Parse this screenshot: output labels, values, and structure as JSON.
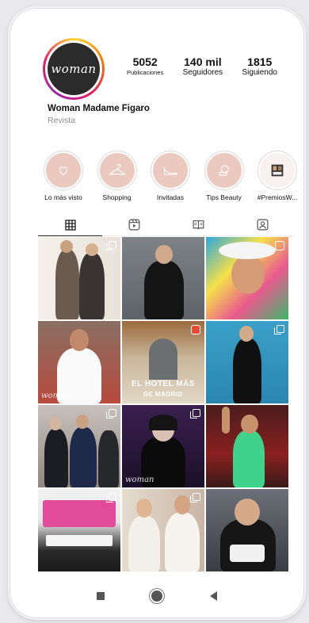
{
  "profile": {
    "avatar_text": "woman",
    "name": "Woman Madame Figaro",
    "category": "Revista",
    "stats": [
      {
        "value": "5052",
        "label": "Publicaciones"
      },
      {
        "value": "140 mil",
        "label": "Seguidores"
      },
      {
        "value": "1815",
        "label": "Siguiendo"
      }
    ]
  },
  "highlights": [
    {
      "label": "Lo más visto",
      "icon": "heart-icon"
    },
    {
      "label": "Shopping",
      "icon": "hanger-icon"
    },
    {
      "label": "Invitadas",
      "icon": "heel-shoe-icon"
    },
    {
      "label": "Tips Beauty",
      "icon": "compact-mirror-icon"
    },
    {
      "label": "#PremiosW...",
      "icon": "award-photo-icon"
    }
  ],
  "tabs": [
    {
      "name": "grid",
      "icon": "grid-icon"
    },
    {
      "name": "reels",
      "icon": "reels-icon"
    },
    {
      "name": "guides",
      "icon": "guide-book-icon"
    },
    {
      "name": "tagged",
      "icon": "tagged-person-icon"
    }
  ],
  "grid": {
    "watermark": "woman",
    "hotel_title": "EL HOTEL MÁS",
    "hotel_subtitle": "DE MADRID"
  },
  "colors": {
    "highlight_fill": "#ebc9bf",
    "accent_ring": "#e91e63",
    "text": "#111111",
    "muted": "#8e8e8e"
  }
}
